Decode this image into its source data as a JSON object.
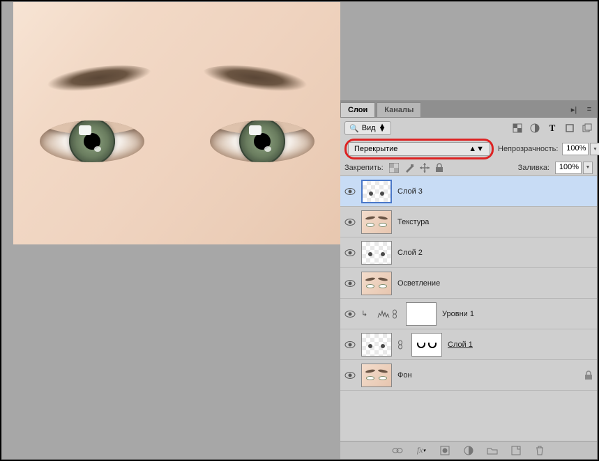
{
  "tabs": {
    "layers": "Слои",
    "channels": "Каналы"
  },
  "filter": {
    "label": "Вид"
  },
  "blend": {
    "mode": "Перекрытие"
  },
  "opacity": {
    "label": "Непрозрачность:",
    "value": "100%"
  },
  "lock": {
    "label": "Закрепить:"
  },
  "fill": {
    "label": "Заливка:",
    "value": "100%"
  },
  "layers": {
    "l1": "Слой 3",
    "l2": "Текстура",
    "l3": "Слой 2",
    "l4": "Осветление",
    "l5": "Уровни 1",
    "l6": "Слой 1",
    "l7": "Фон"
  }
}
